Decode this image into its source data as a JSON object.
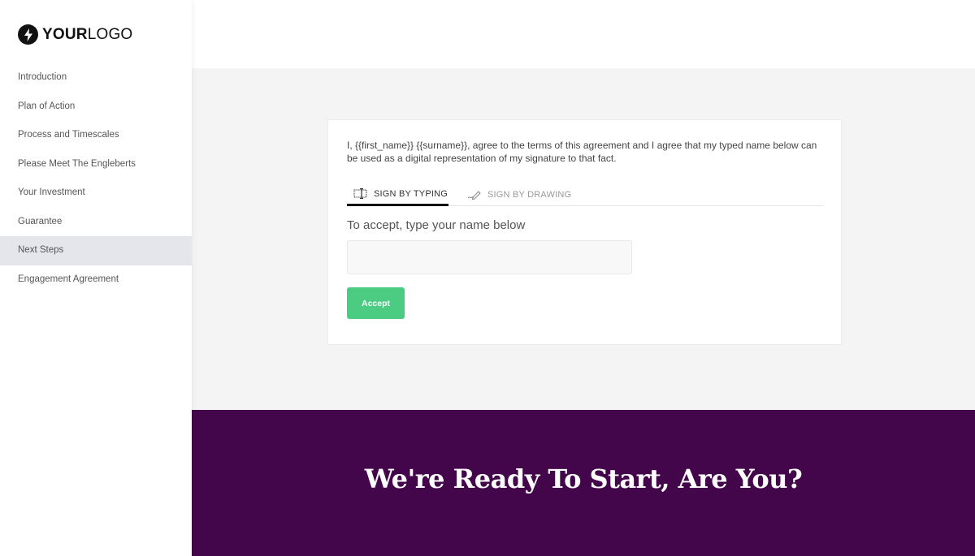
{
  "logo": {
    "icon": "lightning-bolt-icon",
    "text_bold": "YOUR",
    "text_light": "LOGO"
  },
  "sidebar": {
    "items": [
      {
        "label": "Introduction",
        "active": false
      },
      {
        "label": "Plan of Action",
        "active": false
      },
      {
        "label": "Process and Timescales",
        "active": false
      },
      {
        "label": "Please Meet The Engleberts",
        "active": false
      },
      {
        "label": "Your Investment",
        "active": false
      },
      {
        "label": "Guarantee",
        "active": false
      },
      {
        "label": "Next Steps",
        "active": true
      },
      {
        "label": "Engagement Agreement",
        "active": false
      }
    ]
  },
  "signature": {
    "agreement_text": "I, {{first_name}} {{surname}}, agree to the terms of this agreement and I agree that my typed name below can be used as a digital representation of my signature to that fact.",
    "tabs": [
      {
        "label": "SIGN BY TYPING",
        "icon": "text-cursor-icon",
        "active": true
      },
      {
        "label": "SIGN BY DRAWING",
        "icon": "pen-icon",
        "active": false
      }
    ],
    "prompt": "To accept, type your name below",
    "name_value": "",
    "name_placeholder": "",
    "accept_label": "Accept"
  },
  "cta": {
    "title": "We're Ready To Start, Are You?"
  },
  "colors": {
    "accent_green": "#4bcc82",
    "cta_purple": "#43064a",
    "active_nav": "#e4e6ec"
  }
}
